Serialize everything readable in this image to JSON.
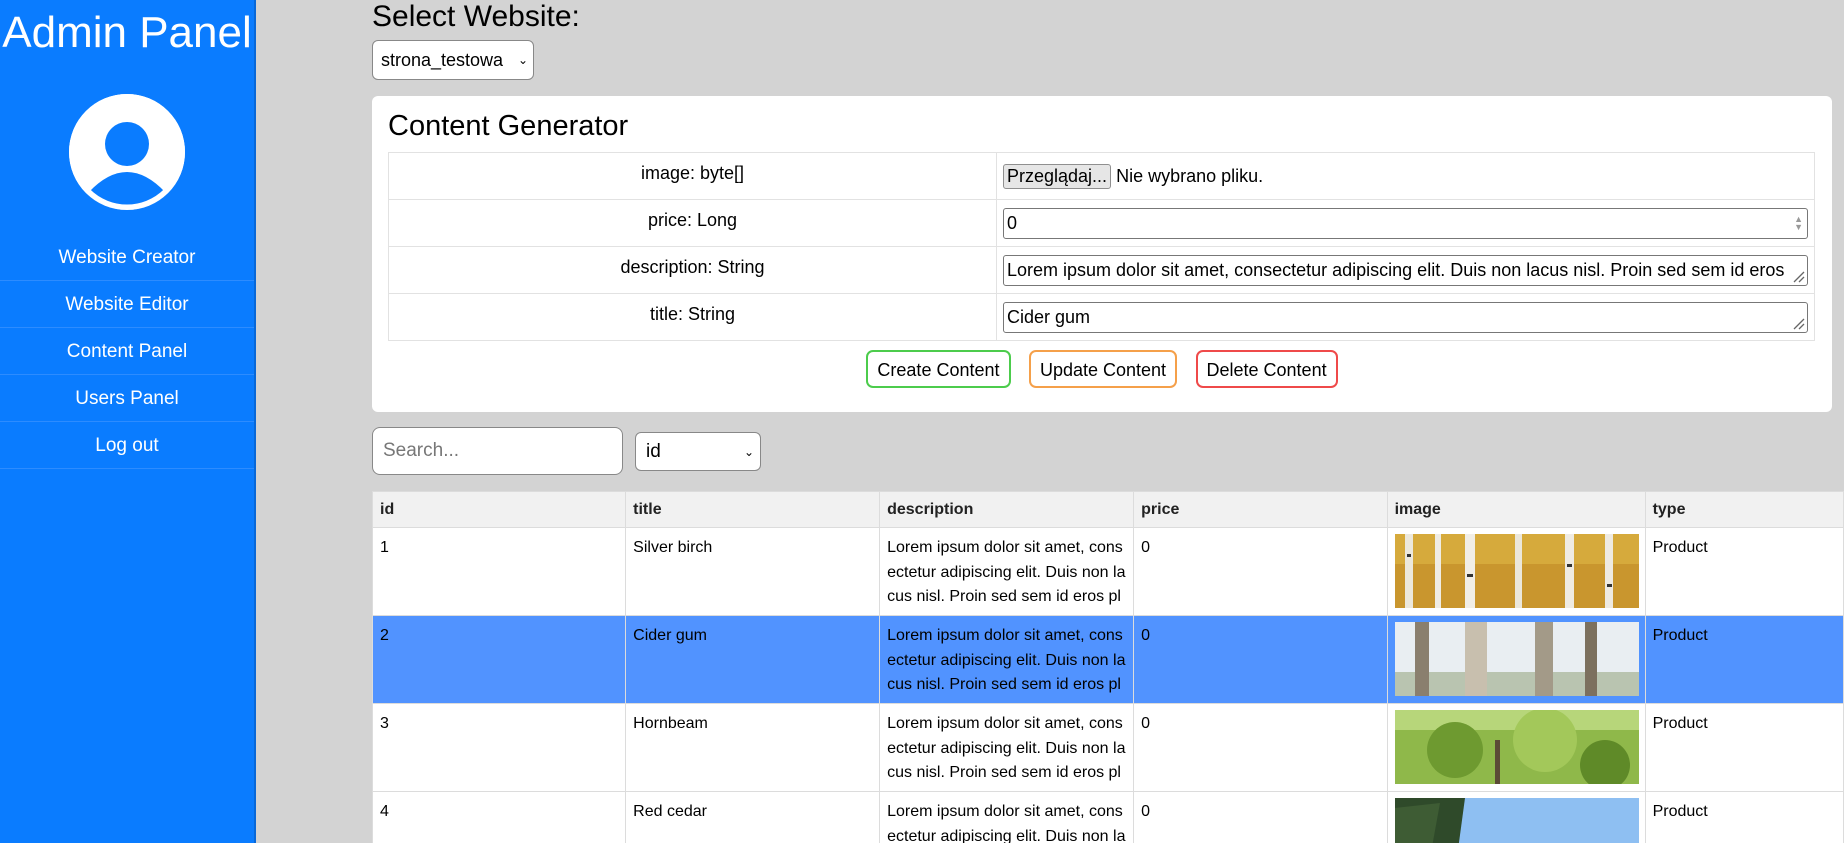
{
  "sidebar": {
    "title": "Admin Panel",
    "nav": [
      {
        "label": "Website Creator"
      },
      {
        "label": "Website Editor"
      },
      {
        "label": "Content Panel"
      },
      {
        "label": "Users Panel"
      },
      {
        "label": "Log out"
      }
    ]
  },
  "website": {
    "heading": "Select Website:",
    "selected": "strona_testowa"
  },
  "generator": {
    "title": "Content Generator",
    "fields": [
      {
        "label": "image: byte[]",
        "button": "Przeglądaj...",
        "value": "Nie wybrano pliku."
      },
      {
        "label": "price: Long",
        "value": "0"
      },
      {
        "label": "description: String",
        "value": "Lorem ipsum dolor sit amet, consectetur adipiscing elit. Duis non lacus nisl. Proin sed sem id eros"
      },
      {
        "label": "title: String",
        "value": "Cider gum"
      }
    ],
    "buttons": {
      "create": "Create Content",
      "update": "Update Content",
      "delete": "Delete Content"
    }
  },
  "search": {
    "placeholder": "Search...",
    "column": "id"
  },
  "table": {
    "headers": [
      "id",
      "title",
      "description",
      "price",
      "image",
      "type"
    ],
    "rows": [
      {
        "id": "1",
        "title": "Silver birch",
        "description": "Lorem ipsum dolor sit amet, consectetur adipiscing elit. Duis non lacus nisl. Proin sed sem id eros pl",
        "price": "0",
        "image": "silver-birch-photo",
        "type": "Product"
      },
      {
        "id": "2",
        "title": "Cider gum",
        "description": "Lorem ipsum dolor sit amet, consectetur adipiscing elit. Duis non lacus nisl. Proin sed sem id eros pl",
        "price": "0",
        "image": "cider-gum-photo",
        "type": "Product",
        "selected": true
      },
      {
        "id": "3",
        "title": "Hornbeam",
        "description": "Lorem ipsum dolor sit amet, consectetur adipiscing elit. Duis non lacus nisl. Proin sed sem id eros pl",
        "price": "0",
        "image": "hornbeam-photo",
        "type": "Product"
      },
      {
        "id": "4",
        "title": "Red cedar",
        "description": "Lorem ipsum dolor sit amet, consectetur adipiscing elit. Duis non lacus nisl. Proin sed sem id eros pl",
        "price": "0",
        "image": "red-cedar-photo",
        "type": "Product"
      }
    ]
  },
  "colors": {
    "sidebar": "#0a7cff",
    "selected_row": "#5193ff",
    "create": "#4ccc4c",
    "update": "#f5a04a",
    "delete": "#ef4a4a"
  }
}
